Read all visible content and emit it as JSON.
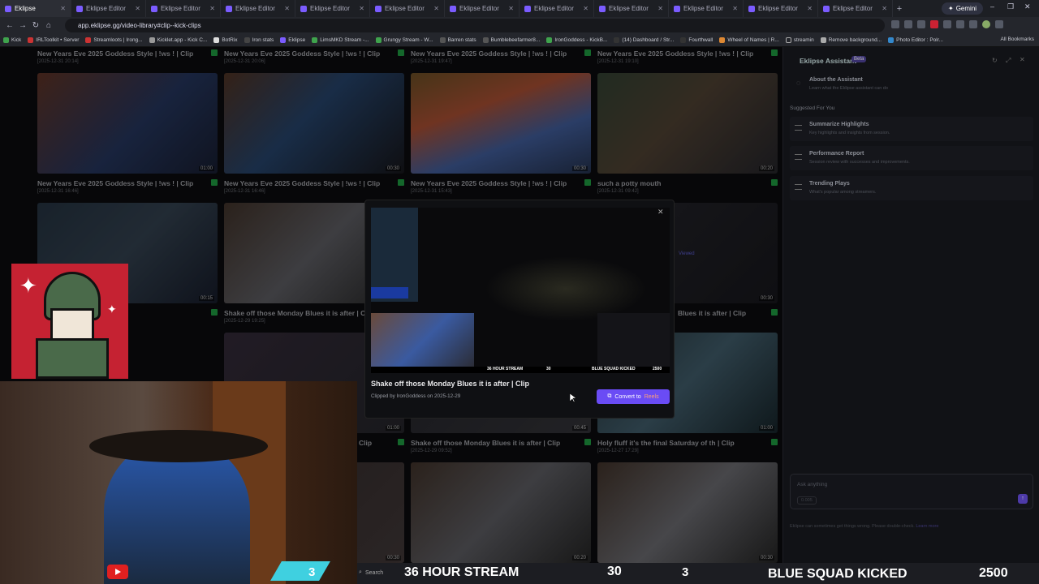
{
  "browser": {
    "active_tab": "Eklipse",
    "tabs": [
      "Eklipse Editor",
      "Eklipse Editor",
      "Eklipse Editor",
      "Eklipse Editor",
      "Eklipse Editor",
      "Eklipse Editor",
      "Eklipse Editor",
      "Eklipse Editor",
      "Eklipse Editor",
      "Eklipse Editor",
      "Eklipse Editor"
    ],
    "gemini_label": "Gemini",
    "url": "app.eklipse.gg/video-library#clip--kick-clips",
    "bookmarks": [
      "Kick",
      "IRLToolkit • Server",
      "Streamloots | Irong...",
      "Kicklet.app - Kick C...",
      "BotRix",
      "Iron stats",
      "Eklipse",
      "LimsMKD Stream -...",
      "Grungy Stream - W...",
      "Barren stats",
      "Bumblebeefarmer8...",
      "IronGoddess - KickB...",
      "(14) Dashboard / Str...",
      "Fourthwall",
      "Wheel of Names | R...",
      "streamin",
      "Remove background...",
      "Photo Editor : Polr..."
    ],
    "all_bookmarks": "All Bookmarks"
  },
  "clips": [
    {
      "title": "New Years Eve 2025 Goddess Style | !ws ! | Clip",
      "date": "[2025-12-31 20:14]",
      "duration": ""
    },
    {
      "title": "New Years Eve 2025 Goddess Style | !ws ! | Clip",
      "date": "[2025-12-31 20:06]",
      "duration": ""
    },
    {
      "title": "New Years Eve 2025 Goddess Style | !ws ! | Clip",
      "date": "[2025-12-31 19:47]",
      "duration": ""
    },
    {
      "title": "New Years Eve 2025 Goddess Style | !ws ! | Clip",
      "date": "[2025-12-31 19:10]",
      "duration": ""
    },
    {
      "title": "New Years Eve 2025 Goddess Style | !ws ! | Clip",
      "date": "[2025-12-31 16:46]",
      "duration": "01:00"
    },
    {
      "title": "New Years Eve 2025 Goddess Style | !ws ! | Clip",
      "date": "[2025-12-31 16:46]",
      "duration": "00:30"
    },
    {
      "title": "New Years Eve 2025 Goddess Style | !ws ! | Clip",
      "date": "[2025-12-31 15:43]",
      "duration": "00:30"
    },
    {
      "title": "such a potty mouth",
      "date": "[2025-12-31 09:42]",
      "duration": "00:20"
    },
    {
      "title": "",
      "date": "",
      "duration": "00:15"
    },
    {
      "title": "Shake off those Monday Blues it is after | C",
      "date": "[2025-12-29 19:25]",
      "duration": ""
    },
    {
      "title": "Blues it is after | Clip",
      "date": "",
      "duration": "00:30"
    },
    {
      "title": "Clip",
      "date": "",
      "duration": "01:00"
    },
    {
      "title": "Shake off those Monday Blues it is after | Clip",
      "date": "[2025-12-29 09:52]",
      "duration": "00:45"
    },
    {
      "title": "Holy fluff it's the final Saturday of th | Clip",
      "date": "[2025-12-27 17:29]",
      "duration": "01:00"
    },
    {
      "title": "",
      "date": "",
      "duration": "00:30"
    },
    {
      "title": "",
      "date": "",
      "duration": "00:20"
    },
    {
      "title": "",
      "date": "",
      "duration": "00:30"
    }
  ],
  "viewed_label": "Viewed",
  "modal": {
    "title": "Shake off those Monday Blues it is after | Clip",
    "meta": "Clipped by IronGoddess on 2025-12-29",
    "convert_prefix": "Convert to",
    "convert_suffix": "Reels",
    "overlay_center": "36 HOUR STREAM",
    "overlay_num": "30",
    "overlay_right": "BLUE SQUAD KICKED",
    "overlay_score": "2500"
  },
  "assistant": {
    "title": "Eklipse Assistant",
    "beta": "Beta",
    "about_title": "About the Assistant",
    "about_sub": "Learn what the Eklipse assistant can do",
    "suggested": "Suggested For You",
    "items": [
      {
        "title": "Summarize Highlights",
        "sub": "Key highlights and insights from session."
      },
      {
        "title": "Performance Report",
        "sub": "Session review with successes and improvements."
      },
      {
        "title": "Trending Plays",
        "sub": "What's popular among streamers."
      }
    ],
    "input_placeholder": "Ask anything",
    "credits": "0.005",
    "disclaimer": "Eklipse can sometimes get things wrong. Please double-check.",
    "learn_more": "Learn more"
  },
  "stream_overlay": {
    "counter_left": "3",
    "search": "Search",
    "hour_stream": "36 HOUR STREAM",
    "num30": "30",
    "counter_right": "3",
    "blue_squad": "BLUE SQUAD KICKED",
    "score": "2500"
  },
  "colors": {
    "accent": "#6a4cf5",
    "green": "#24b24b",
    "logo_red": "#c52232"
  }
}
